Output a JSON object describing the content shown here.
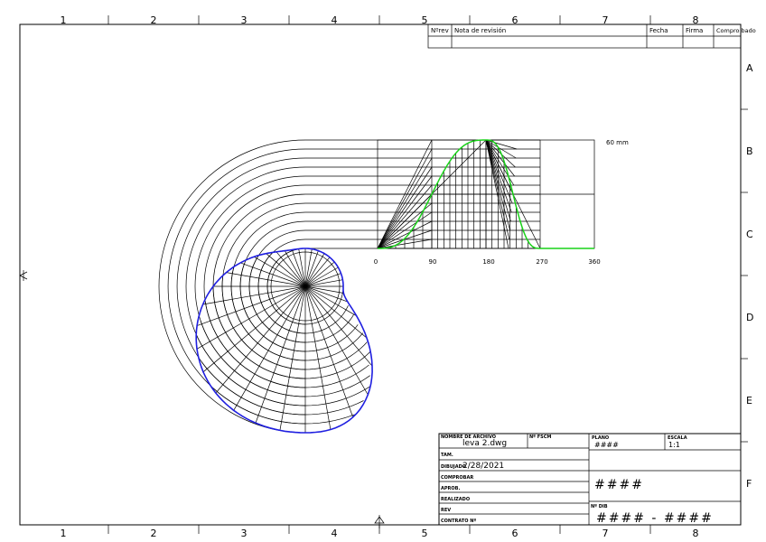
{
  "frame": {
    "columns": [
      "1",
      "2",
      "3",
      "4",
      "5",
      "6",
      "7",
      "8"
    ],
    "rows": [
      "A",
      "B",
      "C",
      "D",
      "E",
      "F"
    ]
  },
  "revision_table": {
    "headers": [
      "Nºrev",
      "Nota de revisión",
      "Fecha",
      "Firma",
      "Compro bado"
    ]
  },
  "diagram": {
    "x_labels": [
      "0",
      "90",
      "180",
      "270",
      "360"
    ],
    "stroke_label": "60 mm",
    "colors": {
      "cam_profile": "#1f1fe0",
      "displacement_curve": "#19d219",
      "lines": "#000000"
    }
  },
  "title_block": {
    "file_name_label": "NOMBRE DE ARCHIVO",
    "file_name": "leva 2.dwg",
    "fscm_label": "Nº FSCM",
    "plano_label": "PLANO",
    "plano_value": "####",
    "escala_label": "ESCALA",
    "escala_value": "1:1",
    "tam_label": "TAM.",
    "dibujado_label": "DIBUJADO",
    "dibujado_value": "2/28/2021",
    "comprobar_label": "COMPROBAR",
    "aprob_label": "APROB.",
    "realizado_label": "REALIZADO",
    "rev_label": "REV",
    "contrato_label": "CONTRATO Nº",
    "title_value": "####",
    "dib_label": "Nº DIB",
    "dib_value": "#### - ####"
  }
}
